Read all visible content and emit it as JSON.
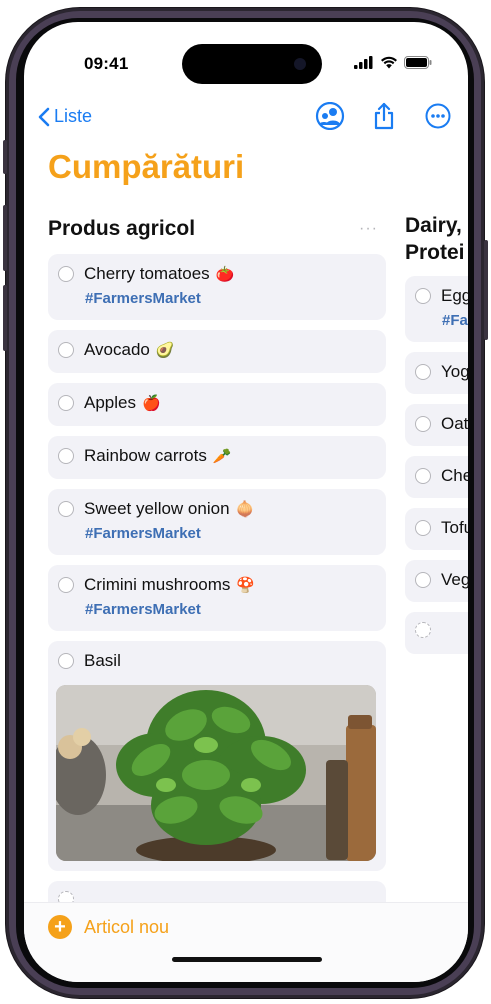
{
  "status": {
    "time": "09:41"
  },
  "nav": {
    "back_label": "Liste"
  },
  "page_title": "Cumpărături",
  "sections": [
    {
      "title": "Produs agricol",
      "more": "···",
      "items": [
        {
          "name": "Cherry tomatoes",
          "emoji": "🍅",
          "tag": "#FarmersMarket"
        },
        {
          "name": "Avocado",
          "emoji": "🥑"
        },
        {
          "name": "Apples",
          "emoji": "🍎"
        },
        {
          "name": "Rainbow carrots",
          "emoji": "🥕"
        },
        {
          "name": "Sweet yellow onion",
          "emoji": "🧅",
          "tag": "#FarmersMarket"
        },
        {
          "name": "Crimini mushrooms",
          "emoji": "🍄",
          "tag": "#FarmersMarket"
        },
        {
          "name": "Basil",
          "has_photo": true
        }
      ]
    },
    {
      "title_line1": "Dairy,",
      "title_line2": "Protei",
      "items": [
        {
          "name": "Egg",
          "tag": "#Fa"
        },
        {
          "name": "Yog"
        },
        {
          "name": "Oat"
        },
        {
          "name": "Che"
        },
        {
          "name": "Tofu"
        },
        {
          "name": "Veg"
        }
      ]
    }
  ],
  "bottom": {
    "new_item_label": "Articol nou"
  },
  "colors": {
    "accent": "#f5a11a",
    "link": "#1a7cf2",
    "tag": "#3e6fb4",
    "card": "#f2f2f7"
  },
  "icons": [
    "chevron-left-icon",
    "share-people-icon",
    "share-icon",
    "more-icon",
    "signal-icon",
    "wifi-icon",
    "battery-icon",
    "plus-icon"
  ]
}
